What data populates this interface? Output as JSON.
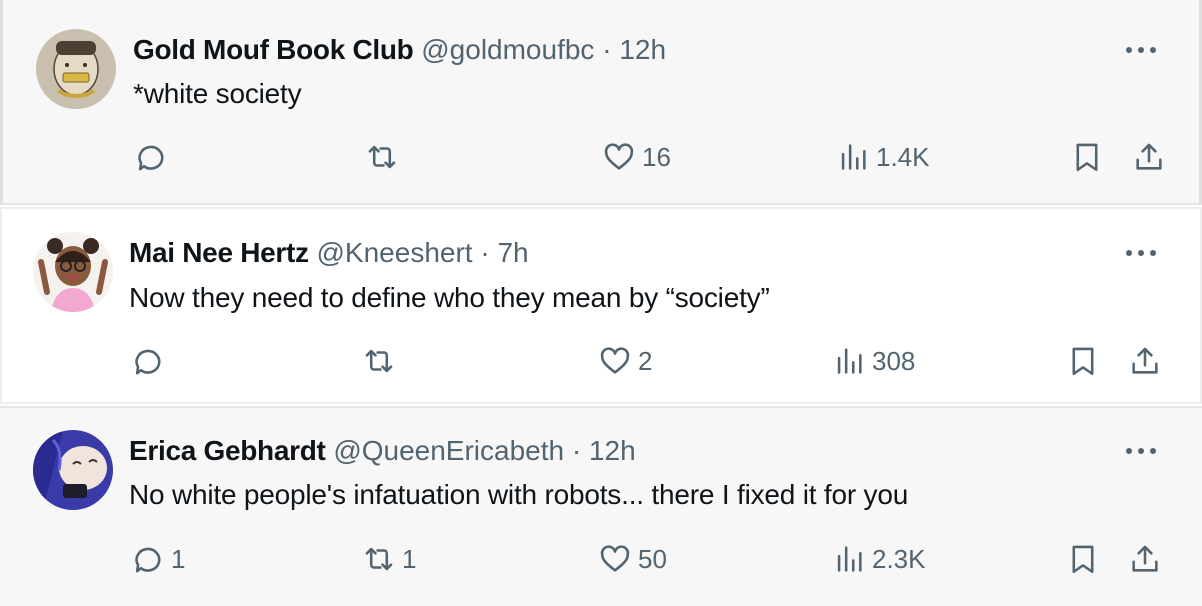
{
  "tweets": [
    {
      "name": "Gold Mouf Book Club",
      "handle": "@goldmoufbc",
      "separator": "·",
      "time": "12h",
      "text": "*white society",
      "replies": "",
      "retweets": "",
      "likes": "16",
      "views": "1.4K"
    },
    {
      "name": "Mai Nee Hertz",
      "handle": "@Kneeshert",
      "separator": "·",
      "time": "7h",
      "text": "Now they need to define who they mean by “society”",
      "replies": "",
      "retweets": "",
      "likes": "2",
      "views": "308"
    },
    {
      "name": "Erica Gebhardt",
      "handle": "@QueenEricabeth",
      "separator": "·",
      "time": "12h",
      "text": "No white people's infatuation with robots... there I fixed it for you",
      "replies": "1",
      "retweets": "1",
      "likes": "50",
      "views": "2.3K"
    }
  ],
  "icons": {
    "reply": "reply-icon",
    "retweet": "retweet-icon",
    "like": "heart-icon",
    "views": "analytics-icon",
    "bookmark": "bookmark-icon",
    "share": "share-icon",
    "more": "more-icon"
  },
  "colors": {
    "text": "#0f1419",
    "secondary": "#536471"
  }
}
